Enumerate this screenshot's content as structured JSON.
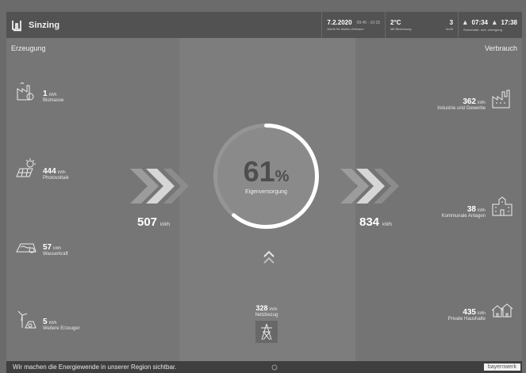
{
  "header": {
    "title": "Sinzing",
    "date": "7.2.2020",
    "date_time": "09:46 - 10:15",
    "date_sub": "Werte für letzten Zeitraum",
    "weather_temp": "2°C",
    "weather_sub": "Mit Bedeckung",
    "wind": "3",
    "wind_unit": "km/h",
    "sunrise": "07:34",
    "sunset": "17:38",
    "sun_sub": "Sonnenauf- und -untergang"
  },
  "left": {
    "heading": "Erzeugung",
    "sources": [
      {
        "icon": "biomass-icon",
        "value": "1",
        "unit": "kWh",
        "label": "Biomasse"
      },
      {
        "icon": "photovoltaic-icon",
        "value": "444",
        "unit": "kWh",
        "label": "Photovoltaik"
      },
      {
        "icon": "hydropower-icon",
        "value": "57",
        "unit": "kWh",
        "label": "Wasserkraft"
      },
      {
        "icon": "other-producers-icon",
        "value": "5",
        "unit": "kWh",
        "label": "Weitere Erzeuger"
      }
    ],
    "total": "507",
    "total_unit": "kWh"
  },
  "center": {
    "percent": "61",
    "percent_sign": "%",
    "percent_value": 61,
    "label": "Eigenversorgung",
    "grid_value": "328",
    "grid_unit": "kWh",
    "grid_label": "Netzbezug"
  },
  "right": {
    "heading": "Verbrauch",
    "consumers": [
      {
        "icon": "industry-icon",
        "value": "362",
        "unit": "kWh",
        "label": "Industrie und Gewerbe"
      },
      {
        "icon": "municipal-icon",
        "value": "38",
        "unit": "kWh",
        "label": "Kommunale Anlagen"
      },
      {
        "icon": "households-icon",
        "value": "435",
        "unit": "kWh",
        "label": "Private Haushalte"
      }
    ],
    "total": "834",
    "total_unit": "kWh"
  },
  "footer": {
    "slogan": "Wir machen die Energiewende in unserer Region sichtbar.",
    "logo": "bayernwerk"
  },
  "colors": {
    "gauge_track": "#909090",
    "gauge_fill": "#ffffff",
    "percent_text": "#4e4e4e"
  }
}
